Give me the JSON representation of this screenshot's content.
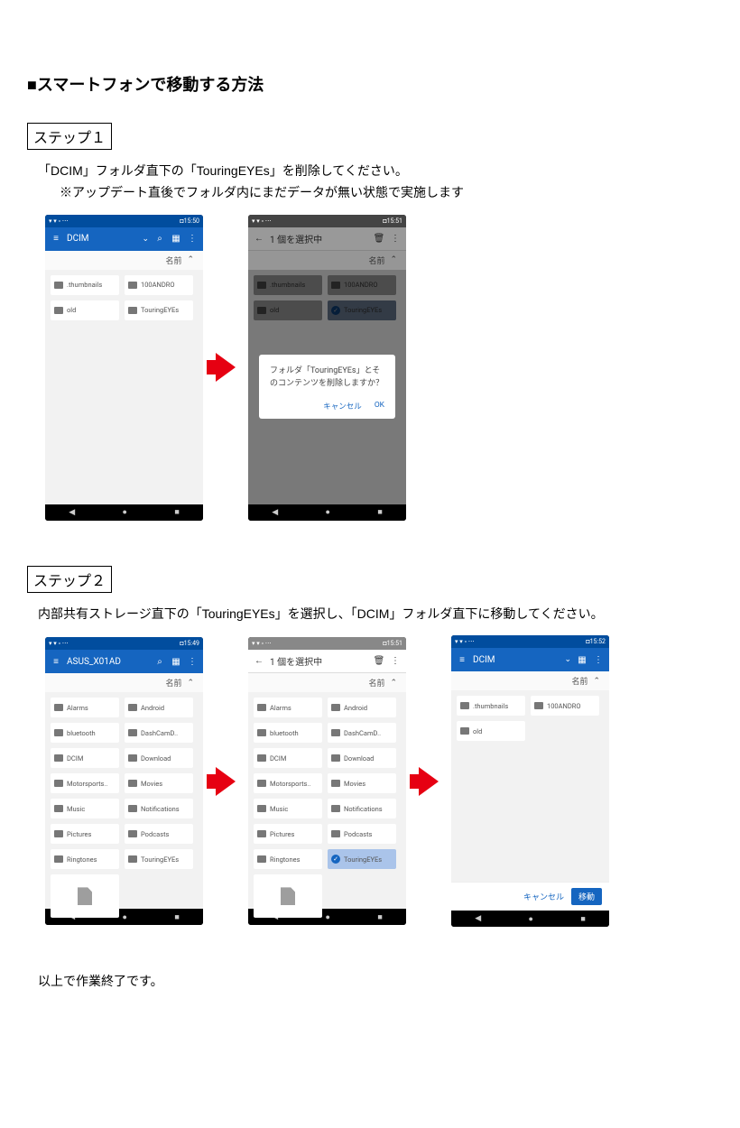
{
  "title": "■スマートフォンで移動する方法",
  "step1": {
    "label": "ステップ１",
    "desc": "「DCIM」フォルダ直下の「TouringEYEs」を削除してください。",
    "note": "※アップデート直後でフォルダ内にまだデータが無い状態で実施します"
  },
  "step2": {
    "label": "ステップ２",
    "desc": "内部共有ストレージ直下の「TouringEYEs」を選択し、「DCIM」フォルダ直下に移動してください。"
  },
  "final": "以上で作業終了です。",
  "common": {
    "sort_label": "名前",
    "status_left": "",
    "nav": {
      "back": "◀",
      "home": "●",
      "recent": "■"
    },
    "battery_icon": "◘"
  },
  "screens": {
    "s1a": {
      "time": "15:50",
      "appbar_title": "DCIM",
      "tiles": [
        ".thumbnails",
        "100ANDRO",
        "old",
        "TouringEYEs"
      ]
    },
    "s1b": {
      "time": "15:51",
      "appbar_title": "1 個を選択中",
      "tiles": [
        ".thumbnails",
        "100ANDRO",
        "old",
        "TouringEYEs"
      ],
      "dialog": {
        "text": "フォルダ「TouringEYEs」とそのコンテンツを削除しますか？",
        "cancel": "キャンセル",
        "ok": "OK"
      }
    },
    "s2a": {
      "time": "15:49",
      "appbar_title": "ASUS_X01AD",
      "tiles": [
        "Alarms",
        "Android",
        "bluetooth",
        "DashCamD..",
        "DCIM",
        "Download",
        "Motorsports..",
        "Movies",
        "Music",
        "Notifications",
        "Pictures",
        "Podcasts",
        "Ringtones",
        "TouringEYEs"
      ]
    },
    "s2b": {
      "time": "15:51",
      "appbar_title": "1 個を選択中",
      "tiles": [
        "Alarms",
        "Android",
        "bluetooth",
        "DashCamD..",
        "DCIM",
        "Download",
        "Motorsports..",
        "Movies",
        "Music",
        "Notifications",
        "Pictures",
        "Podcasts",
        "Ringtones",
        "TouringEYEs"
      ]
    },
    "s2c": {
      "time": "15:52",
      "appbar_title": "DCIM",
      "tiles": [
        ".thumbnails",
        "100ANDRO",
        "old"
      ],
      "footer": {
        "cancel": "キャンセル",
        "move": "移動"
      }
    }
  }
}
